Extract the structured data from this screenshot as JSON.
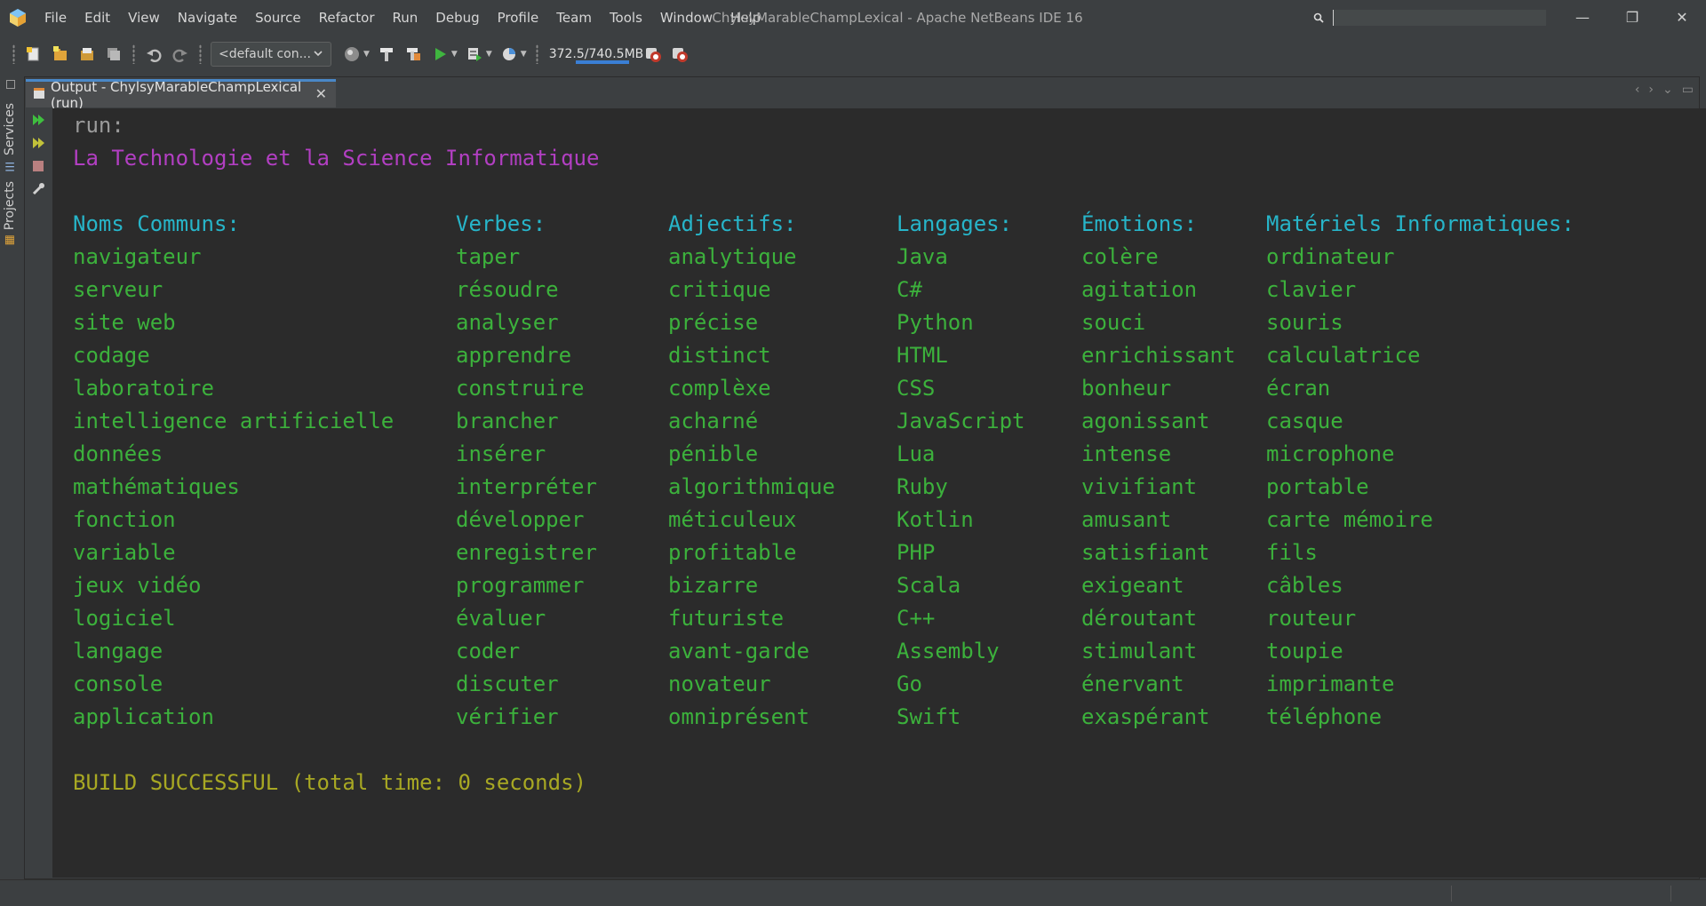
{
  "window": {
    "title": "ChylsyMarableChampLexical - Apache NetBeans IDE 16",
    "minimize": "—",
    "restore": "❐",
    "close": "✕"
  },
  "menu": [
    "File",
    "Edit",
    "View",
    "Navigate",
    "Source",
    "Refactor",
    "Run",
    "Debug",
    "Profile",
    "Team",
    "Tools",
    "Window",
    "Help"
  ],
  "search": {
    "placeholder": ""
  },
  "toolbar": {
    "config": "<default con...",
    "memory": "372.5/740.5MB",
    "memory_used_fraction": 0.503
  },
  "sidebar": {
    "services": "Services",
    "projects": "Projects"
  },
  "output": {
    "tab_label": "Output - ChylsyMarableChampLexical (run)",
    "run": "run:",
    "title": "La Technologie et la Science Informatique",
    "headers": [
      "Noms Communs:",
      "Verbes:",
      "Adjectifs:",
      "Langages:",
      "Émotions:",
      "Matériels Informatiques:"
    ],
    "rows": [
      [
        "navigateur",
        "taper",
        "analytique",
        "Java",
        "colère",
        "ordinateur"
      ],
      [
        "serveur",
        "résoudre",
        "critique",
        "C#",
        "agitation",
        "clavier"
      ],
      [
        "site web",
        "analyser",
        "précise",
        "Python",
        "souci",
        "souris"
      ],
      [
        "codage",
        "apprendre",
        "distinct",
        "HTML",
        "enrichissant",
        "calculatrice"
      ],
      [
        "laboratoire",
        "construire",
        "complèxe",
        "CSS",
        "bonheur",
        "écran"
      ],
      [
        "intelligence artificielle",
        "brancher",
        "acharné",
        "JavaScript",
        "agonissant",
        "casque"
      ],
      [
        "données",
        "insérer",
        "pénible",
        "Lua",
        "intense",
        "microphone"
      ],
      [
        "mathématiques",
        "interpréter",
        "algorithmique",
        "Ruby",
        "vivifiant",
        "portable"
      ],
      [
        "fonction",
        "développer",
        "méticuleux",
        "Kotlin",
        "amusant",
        "carte mémoire"
      ],
      [
        "variable",
        "enregistrer",
        "profitable",
        "PHP",
        "satisfiant",
        "fils"
      ],
      [
        "jeux vidéo",
        "programmer",
        "bizarre",
        "Scala",
        "exigeant",
        "câbles"
      ],
      [
        "logiciel",
        "évaluer",
        "futuriste",
        "C++",
        "déroutant",
        "routeur"
      ],
      [
        "langage",
        "coder",
        "avant-garde",
        "Assembly",
        "stimulant",
        "toupie"
      ],
      [
        "console",
        "discuter",
        "novateur",
        "Go",
        "énervant",
        "imprimante"
      ],
      [
        "application",
        "vérifier",
        "omniprésent",
        "Swift",
        "exaspérant",
        "téléphone"
      ]
    ],
    "build": "BUILD SUCCESSFUL (total time: 0 seconds)"
  },
  "colors": {
    "run": "#9b9b9b",
    "title": "#b23fc2",
    "headers": "#27b5c9",
    "words": "#3cb13c",
    "build": "#a8a823",
    "console_bg": "#2b2b2b"
  }
}
